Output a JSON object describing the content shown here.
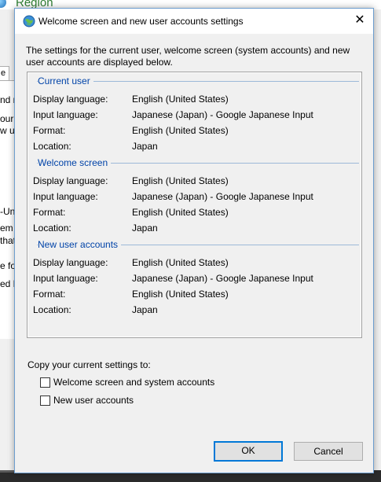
{
  "background": {
    "title": "Region",
    "tab_label": "e",
    "fragments": [
      "nd r",
      "our l",
      "w us",
      "-Uni",
      "em l",
      "that",
      "e fo",
      "ed K"
    ]
  },
  "dialog": {
    "title": "Welcome screen and new user accounts settings",
    "close_symbol": "✕",
    "intro": "The settings for the current user, welcome screen (system accounts) and new user accounts are displayed below.",
    "sections": [
      {
        "heading": "Current user",
        "rows": [
          {
            "label": "Display language:",
            "value": "English (United States)"
          },
          {
            "label": "Input language:",
            "value": "Japanese (Japan) - Google Japanese Input"
          },
          {
            "label": "Format:",
            "value": "English (United States)"
          },
          {
            "label": "Location:",
            "value": "Japan"
          }
        ]
      },
      {
        "heading": "Welcome screen",
        "rows": [
          {
            "label": "Display language:",
            "value": "English (United States)"
          },
          {
            "label": "Input language:",
            "value": "Japanese (Japan) - Google Japanese Input"
          },
          {
            "label": "Format:",
            "value": "English (United States)"
          },
          {
            "label": "Location:",
            "value": "Japan"
          }
        ]
      },
      {
        "heading": "New user accounts",
        "rows": [
          {
            "label": "Display language:",
            "value": "English (United States)"
          },
          {
            "label": "Input language:",
            "value": "Japanese (Japan) - Google Japanese Input"
          },
          {
            "label": "Format:",
            "value": "English (United States)"
          },
          {
            "label": "Location:",
            "value": "Japan"
          }
        ]
      }
    ],
    "copy_label": "Copy your current settings to:",
    "checkboxes": [
      {
        "label": "Welcome screen and system accounts",
        "checked": false
      },
      {
        "label": "New user accounts",
        "checked": false
      }
    ],
    "ok_label": "OK",
    "cancel_label": "Cancel"
  },
  "colors": {
    "section_heading": "#0043a8",
    "default_button_border": "#0078d7",
    "region_title": "#2e7d32"
  }
}
